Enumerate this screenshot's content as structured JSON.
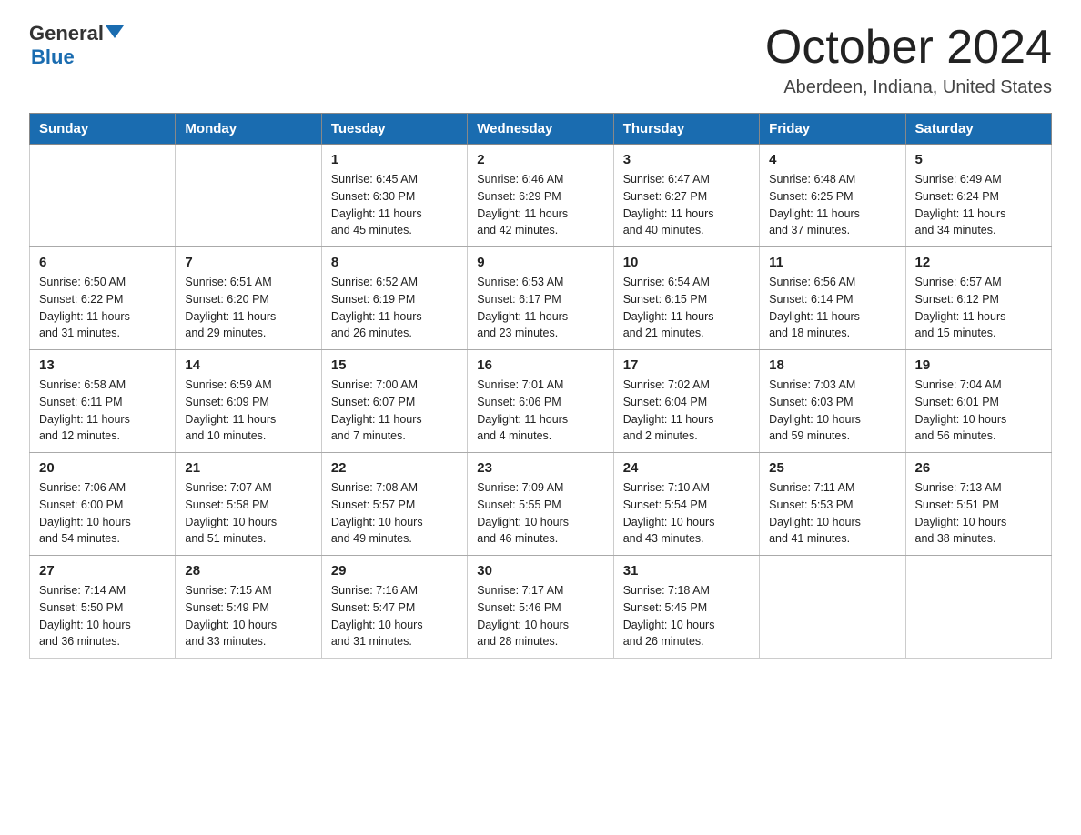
{
  "header": {
    "logo_general": "General",
    "logo_blue": "Blue",
    "month_year": "October 2024",
    "location": "Aberdeen, Indiana, United States"
  },
  "calendar": {
    "days_of_week": [
      "Sunday",
      "Monday",
      "Tuesday",
      "Wednesday",
      "Thursday",
      "Friday",
      "Saturday"
    ],
    "weeks": [
      [
        {
          "day": "",
          "info": ""
        },
        {
          "day": "",
          "info": ""
        },
        {
          "day": "1",
          "info": "Sunrise: 6:45 AM\nSunset: 6:30 PM\nDaylight: 11 hours\nand 45 minutes."
        },
        {
          "day": "2",
          "info": "Sunrise: 6:46 AM\nSunset: 6:29 PM\nDaylight: 11 hours\nand 42 minutes."
        },
        {
          "day": "3",
          "info": "Sunrise: 6:47 AM\nSunset: 6:27 PM\nDaylight: 11 hours\nand 40 minutes."
        },
        {
          "day": "4",
          "info": "Sunrise: 6:48 AM\nSunset: 6:25 PM\nDaylight: 11 hours\nand 37 minutes."
        },
        {
          "day": "5",
          "info": "Sunrise: 6:49 AM\nSunset: 6:24 PM\nDaylight: 11 hours\nand 34 minutes."
        }
      ],
      [
        {
          "day": "6",
          "info": "Sunrise: 6:50 AM\nSunset: 6:22 PM\nDaylight: 11 hours\nand 31 minutes."
        },
        {
          "day": "7",
          "info": "Sunrise: 6:51 AM\nSunset: 6:20 PM\nDaylight: 11 hours\nand 29 minutes."
        },
        {
          "day": "8",
          "info": "Sunrise: 6:52 AM\nSunset: 6:19 PM\nDaylight: 11 hours\nand 26 minutes."
        },
        {
          "day": "9",
          "info": "Sunrise: 6:53 AM\nSunset: 6:17 PM\nDaylight: 11 hours\nand 23 minutes."
        },
        {
          "day": "10",
          "info": "Sunrise: 6:54 AM\nSunset: 6:15 PM\nDaylight: 11 hours\nand 21 minutes."
        },
        {
          "day": "11",
          "info": "Sunrise: 6:56 AM\nSunset: 6:14 PM\nDaylight: 11 hours\nand 18 minutes."
        },
        {
          "day": "12",
          "info": "Sunrise: 6:57 AM\nSunset: 6:12 PM\nDaylight: 11 hours\nand 15 minutes."
        }
      ],
      [
        {
          "day": "13",
          "info": "Sunrise: 6:58 AM\nSunset: 6:11 PM\nDaylight: 11 hours\nand 12 minutes."
        },
        {
          "day": "14",
          "info": "Sunrise: 6:59 AM\nSunset: 6:09 PM\nDaylight: 11 hours\nand 10 minutes."
        },
        {
          "day": "15",
          "info": "Sunrise: 7:00 AM\nSunset: 6:07 PM\nDaylight: 11 hours\nand 7 minutes."
        },
        {
          "day": "16",
          "info": "Sunrise: 7:01 AM\nSunset: 6:06 PM\nDaylight: 11 hours\nand 4 minutes."
        },
        {
          "day": "17",
          "info": "Sunrise: 7:02 AM\nSunset: 6:04 PM\nDaylight: 11 hours\nand 2 minutes."
        },
        {
          "day": "18",
          "info": "Sunrise: 7:03 AM\nSunset: 6:03 PM\nDaylight: 10 hours\nand 59 minutes."
        },
        {
          "day": "19",
          "info": "Sunrise: 7:04 AM\nSunset: 6:01 PM\nDaylight: 10 hours\nand 56 minutes."
        }
      ],
      [
        {
          "day": "20",
          "info": "Sunrise: 7:06 AM\nSunset: 6:00 PM\nDaylight: 10 hours\nand 54 minutes."
        },
        {
          "day": "21",
          "info": "Sunrise: 7:07 AM\nSunset: 5:58 PM\nDaylight: 10 hours\nand 51 minutes."
        },
        {
          "day": "22",
          "info": "Sunrise: 7:08 AM\nSunset: 5:57 PM\nDaylight: 10 hours\nand 49 minutes."
        },
        {
          "day": "23",
          "info": "Sunrise: 7:09 AM\nSunset: 5:55 PM\nDaylight: 10 hours\nand 46 minutes."
        },
        {
          "day": "24",
          "info": "Sunrise: 7:10 AM\nSunset: 5:54 PM\nDaylight: 10 hours\nand 43 minutes."
        },
        {
          "day": "25",
          "info": "Sunrise: 7:11 AM\nSunset: 5:53 PM\nDaylight: 10 hours\nand 41 minutes."
        },
        {
          "day": "26",
          "info": "Sunrise: 7:13 AM\nSunset: 5:51 PM\nDaylight: 10 hours\nand 38 minutes."
        }
      ],
      [
        {
          "day": "27",
          "info": "Sunrise: 7:14 AM\nSunset: 5:50 PM\nDaylight: 10 hours\nand 36 minutes."
        },
        {
          "day": "28",
          "info": "Sunrise: 7:15 AM\nSunset: 5:49 PM\nDaylight: 10 hours\nand 33 minutes."
        },
        {
          "day": "29",
          "info": "Sunrise: 7:16 AM\nSunset: 5:47 PM\nDaylight: 10 hours\nand 31 minutes."
        },
        {
          "day": "30",
          "info": "Sunrise: 7:17 AM\nSunset: 5:46 PM\nDaylight: 10 hours\nand 28 minutes."
        },
        {
          "day": "31",
          "info": "Sunrise: 7:18 AM\nSunset: 5:45 PM\nDaylight: 10 hours\nand 26 minutes."
        },
        {
          "day": "",
          "info": ""
        },
        {
          "day": "",
          "info": ""
        }
      ]
    ]
  }
}
